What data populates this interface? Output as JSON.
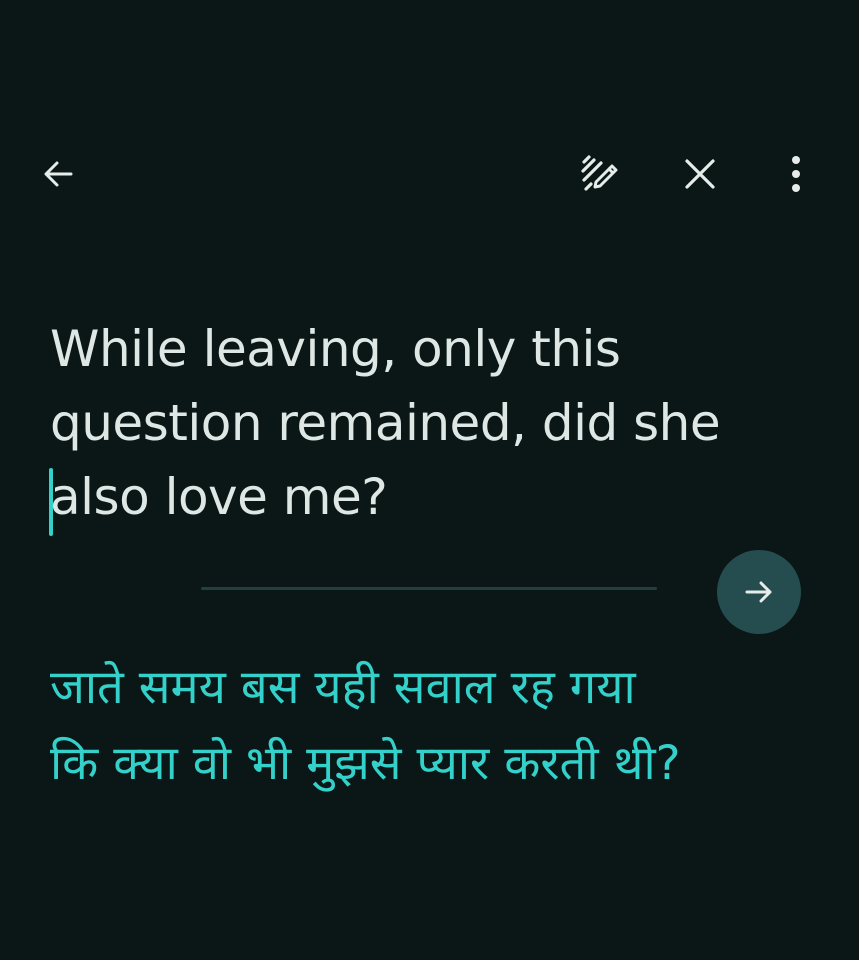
{
  "toolbar": {
    "back_icon": "arrow-left-icon",
    "handwriting_icon": "handwriting-pen-icon",
    "close_icon": "close-icon",
    "more_icon": "more-vertical-icon"
  },
  "source": {
    "lines": [
      "While leaving, only this",
      "question remained, did she",
      "also love me?"
    ]
  },
  "translation": {
    "lines": [
      "जाते समय बस यही सवाल रह गया",
      "कि क्या वो भी मुझसे प्यार करती थी?"
    ]
  },
  "translate_button": {
    "icon": "arrow-right-icon"
  },
  "colors": {
    "background": "#0a1716",
    "source_text": "#dfe7e5",
    "translation_text": "#33d1ca",
    "accent_button": "#254d4f",
    "divider": "#22403e",
    "caret": "#35d0c9"
  }
}
